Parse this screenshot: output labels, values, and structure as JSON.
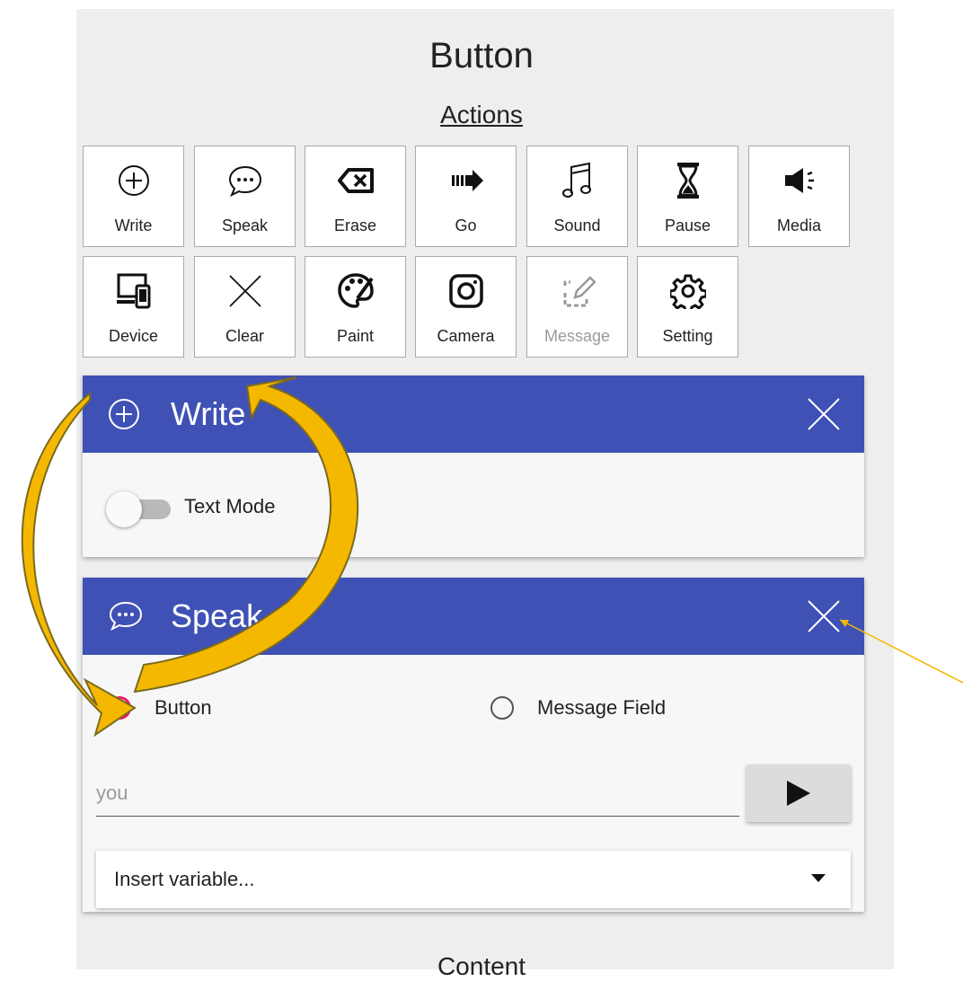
{
  "header": {
    "title": "Button",
    "section": "Actions"
  },
  "actions": [
    {
      "label": "Write",
      "icon": "plus-circle-icon"
    },
    {
      "label": "Speak",
      "icon": "speech-bubble-icon"
    },
    {
      "label": "Erase",
      "icon": "backspace-icon"
    },
    {
      "label": "Go",
      "icon": "arrow-right-icon"
    },
    {
      "label": "Sound",
      "icon": "music-note-icon"
    },
    {
      "label": "Pause",
      "icon": "hourglass-icon"
    },
    {
      "label": "Media",
      "icon": "speaker-icon"
    },
    {
      "label": "Device",
      "icon": "devices-icon"
    },
    {
      "label": "Clear",
      "icon": "x-icon"
    },
    {
      "label": "Paint",
      "icon": "palette-icon"
    },
    {
      "label": "Camera",
      "icon": "camera-icon"
    },
    {
      "label": "Message",
      "icon": "edit-box-icon",
      "disabled": true
    },
    {
      "label": "Setting",
      "icon": "gear-icon"
    }
  ],
  "write_card": {
    "title": "Write",
    "toggle_label": "Text Mode",
    "toggle_on": false
  },
  "speak_card": {
    "title": "Speak",
    "radio_options": [
      "Button",
      "Message Field"
    ],
    "selected": "Button",
    "input_value": "you",
    "variable_select": "Insert variable..."
  },
  "footer": {
    "next_section": "Content"
  },
  "colors": {
    "header": "#3f51b5",
    "radio_selected": "#e91e63",
    "overlay_arrow": "#f5b800"
  }
}
